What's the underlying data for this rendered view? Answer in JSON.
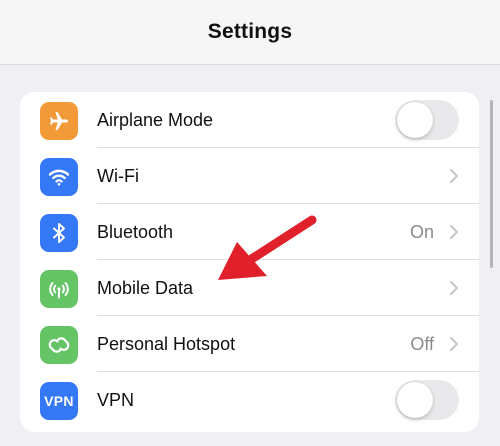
{
  "header": {
    "title": "Settings"
  },
  "colors": {
    "airplane": "#f19a37",
    "wifi": "#3478f6",
    "bluetooth": "#3478f6",
    "mobile_data": "#65c466",
    "hotspot": "#65c466",
    "vpn": "#3478f6",
    "annotation_arrow": "#e0202a"
  },
  "rows": [
    {
      "label": "Airplane Mode",
      "icon": "airplane-icon",
      "control": "toggle",
      "on": false
    },
    {
      "label": "Wi-Fi",
      "icon": "wifi-icon",
      "value": "",
      "control": "chevron"
    },
    {
      "label": "Bluetooth",
      "icon": "bluetooth-icon",
      "value": "On",
      "control": "chevron"
    },
    {
      "label": "Mobile Data",
      "icon": "antenna-icon",
      "value": "",
      "control": "chevron"
    },
    {
      "label": "Personal Hotspot",
      "icon": "hotspot-icon",
      "value": "Off",
      "control": "chevron"
    },
    {
      "label": "VPN",
      "icon": "vpn-icon",
      "icon_text": "VPN",
      "control": "toggle",
      "on": false
    }
  ]
}
